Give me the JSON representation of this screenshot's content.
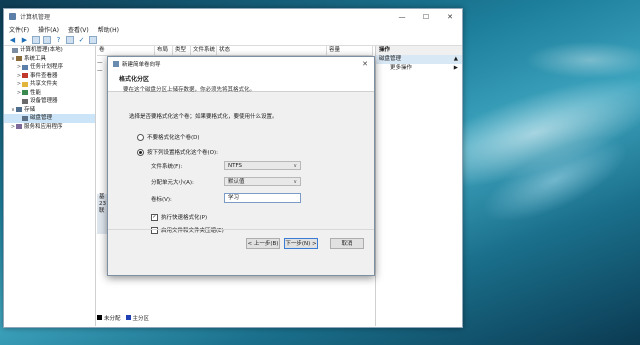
{
  "window": {
    "title": "计算机管理",
    "controls": [
      "—",
      "☐",
      "✕"
    ]
  },
  "menu": [
    "文件(F)",
    "操作(A)",
    "查看(V)",
    "帮助(H)"
  ],
  "tree": [
    {
      "label": "计算机管理(本地)",
      "level": 0,
      "twisty": "",
      "icon": "computer-icon"
    },
    {
      "label": "系统工具",
      "level": 1,
      "twisty": "∨",
      "icon": "tools-icon"
    },
    {
      "label": "任务计划程序",
      "level": 2,
      "twisty": ">",
      "icon": "clock-icon"
    },
    {
      "label": "事件查看器",
      "level": 2,
      "twisty": ">",
      "icon": "event-icon"
    },
    {
      "label": "共享文件夹",
      "level": 2,
      "twisty": ">",
      "icon": "folder-icon"
    },
    {
      "label": "性能",
      "level": 2,
      "twisty": ">",
      "icon": "performance-icon"
    },
    {
      "label": "设备管理器",
      "level": 2,
      "twisty": "",
      "icon": "device-icon"
    },
    {
      "label": "存储",
      "level": 1,
      "twisty": "∨",
      "icon": "storage-icon"
    },
    {
      "label": "磁盘管理",
      "level": 2,
      "twisty": "",
      "icon": "disk-icon",
      "selected": true
    },
    {
      "label": "服务和应用程序",
      "level": 1,
      "twisty": ">",
      "icon": "services-icon"
    }
  ],
  "columns": [
    "卷",
    "布局",
    "类型",
    "文件系统",
    "状态",
    "容量"
  ],
  "volumes": [
    {
      "label": "—"
    },
    {
      "label": "—"
    }
  ],
  "disk_info": [
    "基",
    "23",
    "联"
  ],
  "legend": [
    {
      "label": "未分配",
      "color": "#000000"
    },
    {
      "label": "主分区",
      "color": "#1f3fb5"
    }
  ],
  "actions": {
    "header": "操作",
    "section": "磁盘管理",
    "more": "更多操作"
  },
  "dialog": {
    "title": "新建简单卷向导",
    "close": "✕",
    "heading": "格式化分区",
    "subheading": "要在这个磁盘分区上储存数据，你必须先将其格式化。",
    "prompt": "选择是否要格式化这个卷；如果要格式化，要使用什么设置。",
    "option_no_format": "不要格式化这个卷(D)",
    "option_format": "按下列设置格式化这个卷(O):",
    "selected_option": "format",
    "fs_label": "文件系统(F):",
    "fs_value": "NTFS",
    "alloc_label": "分配单元大小(A):",
    "alloc_value": "默认值",
    "vol_label_label": "卷标(V):",
    "vol_label_value": "学习",
    "quick_format": "执行快速格式化(P)",
    "quick_format_checked": true,
    "compress": "启用文件和文件夹压缩(E)",
    "compress_checked": false,
    "back": "< 上一步(B)",
    "next": "下一步(N) >",
    "cancel": "取消"
  },
  "colors": {
    "accent": "#3a7bd5",
    "selection": "#cce4f7"
  }
}
